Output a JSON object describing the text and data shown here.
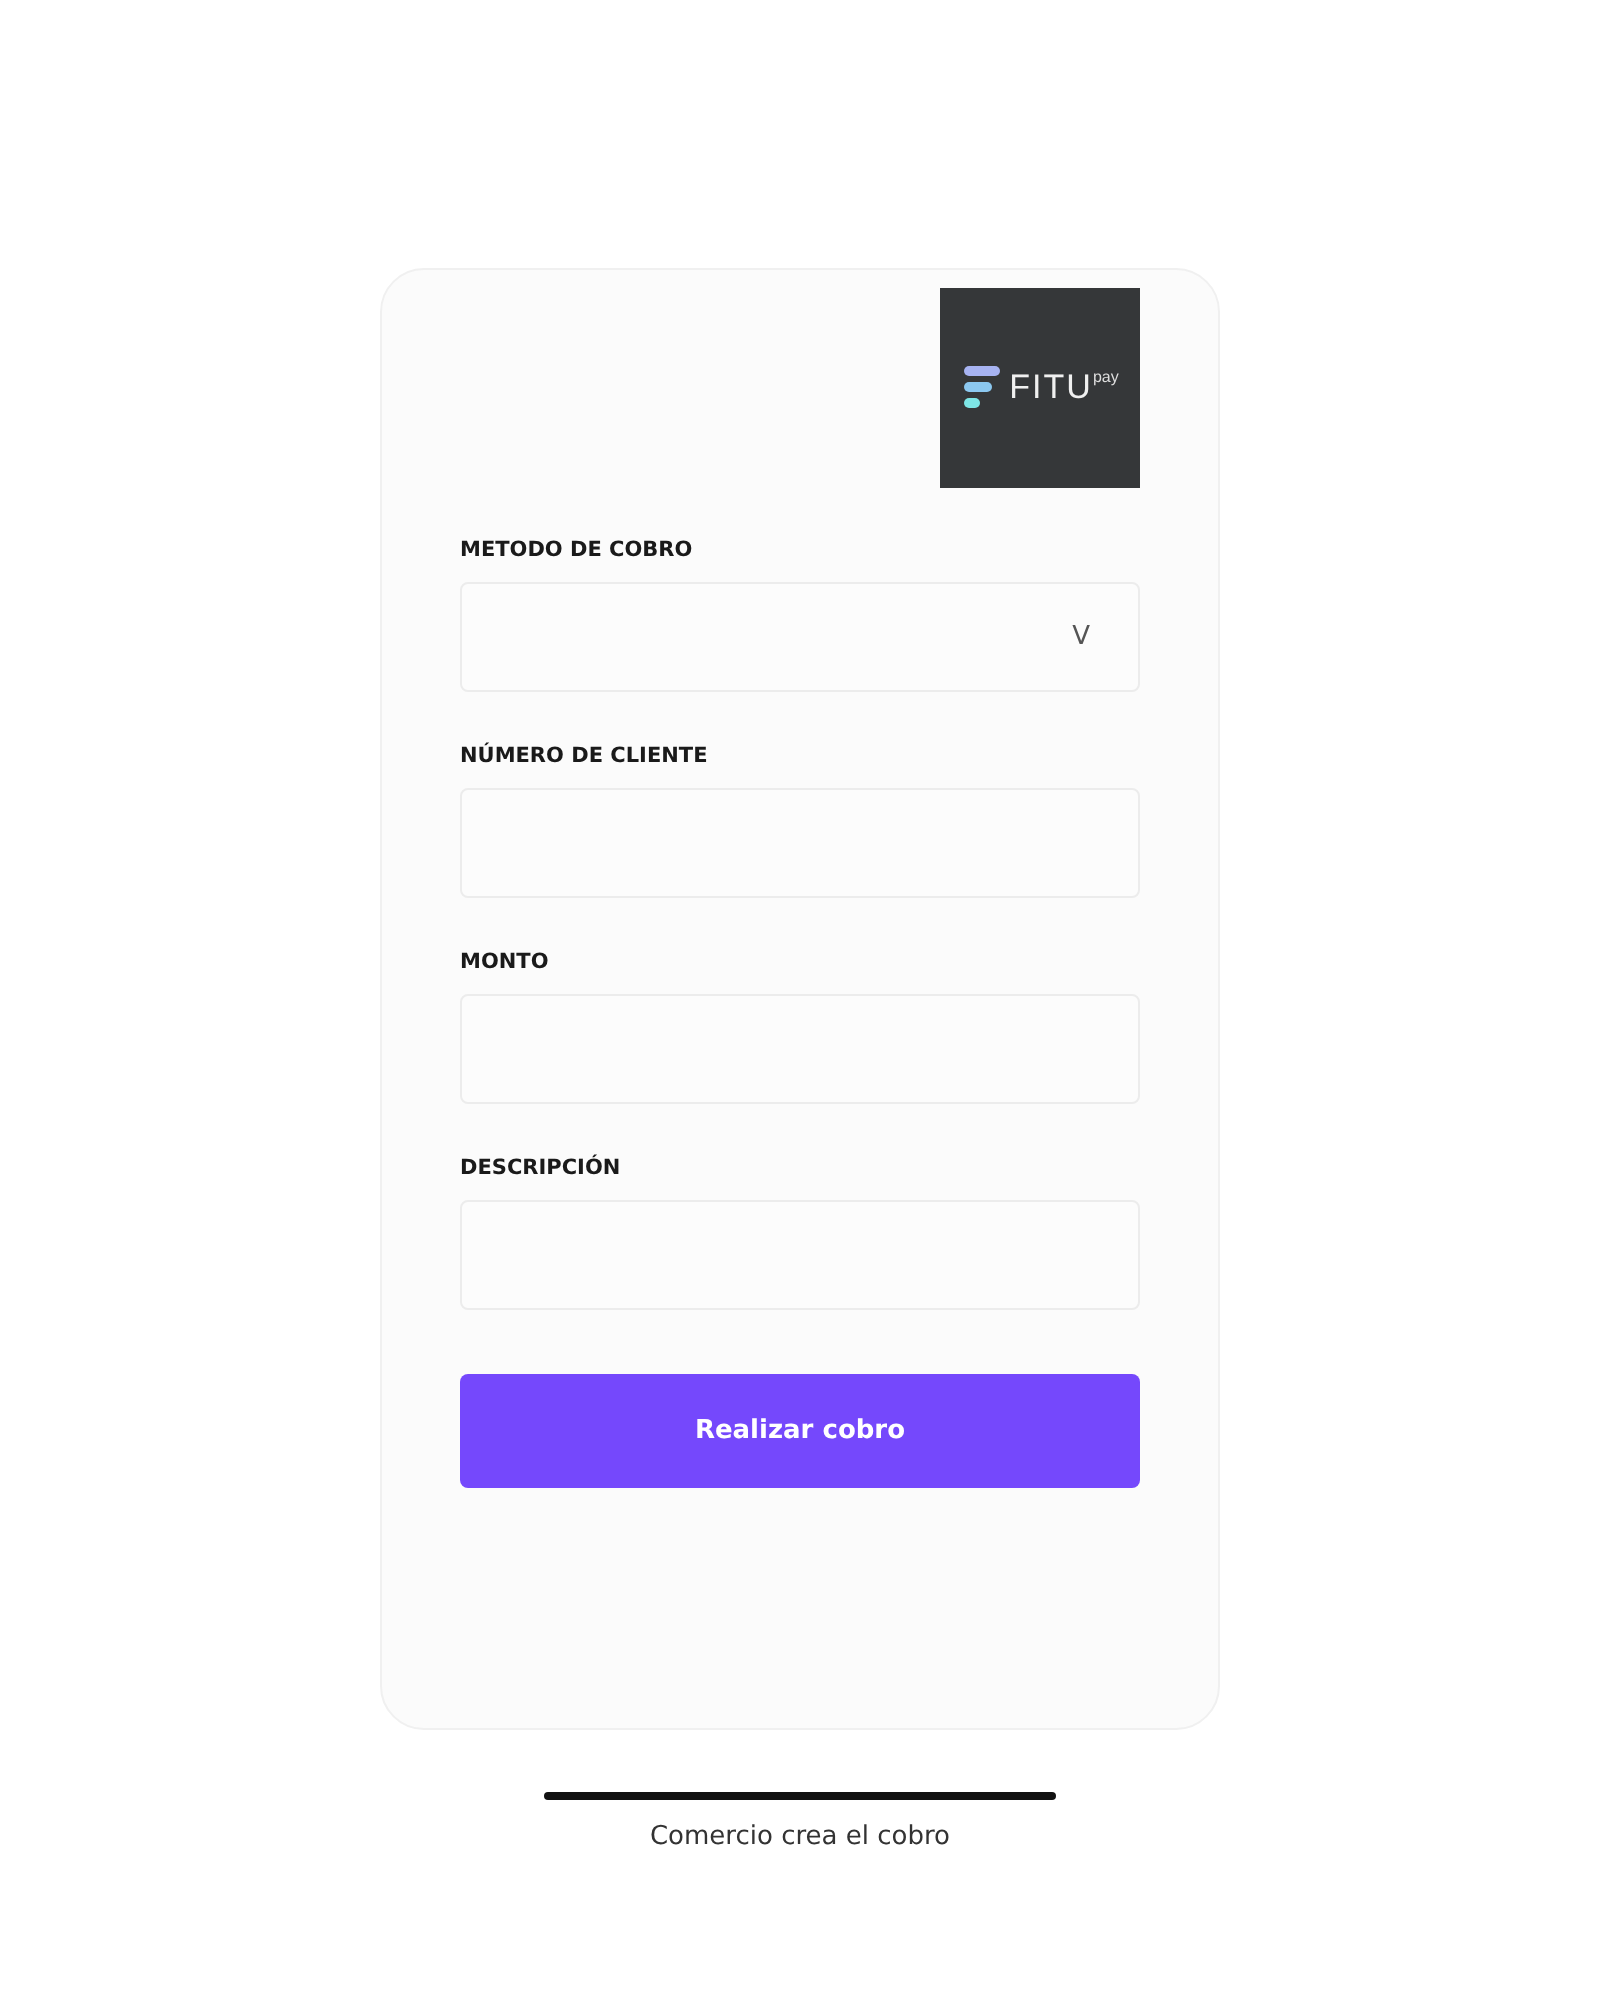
{
  "logo": {
    "name": "FITU",
    "superscript": "pay"
  },
  "fields": [
    {
      "kind": "select",
      "label": "METODO DE COBRO",
      "chevron": "V"
    },
    {
      "kind": "text",
      "label": "NÚMERO DE CLIENTE"
    },
    {
      "kind": "text",
      "label": "MONTO"
    },
    {
      "kind": "text",
      "label": "DESCRIPCIÓN"
    }
  ],
  "submit_button": "Realizar cobro",
  "caption": "Comercio crea el cobro"
}
